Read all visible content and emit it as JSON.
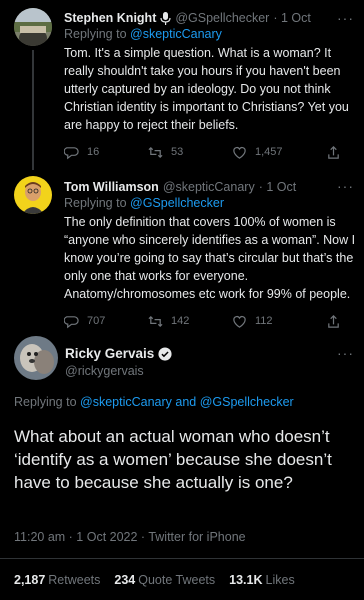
{
  "tweets": [
    {
      "name": "Stephen Knight",
      "handle": "@GSpellchecker",
      "time": "· 1 Oct",
      "reply_prefix": "Replying to ",
      "reply_to": "@skepticCanary",
      "text": "Tom. It's a simple question. What is a woman? It really shouldn't take you hours if you haven't been utterly captured by an ideology. Do you not think Christian identity is important to Christians? Yet you are happy to reject their beliefs.",
      "replies": "16",
      "retweets": "53",
      "likes": "1,457"
    },
    {
      "name": "Tom Williamson",
      "handle": "@skepticCanary",
      "time": "· 1 Oct",
      "reply_prefix": "Replying to ",
      "reply_to": "@GSpellchecker",
      "text": "The only definition that covers 100% of women is “anyone who sincerely identifies as a woman”. Now I know you’re going to say that’s circular but that’s the only one that works for everyone. Anatomy/chromosomes etc work for 99% of people.",
      "replies": "707",
      "retweets": "142",
      "likes": "112"
    }
  ],
  "main": {
    "name": "Ricky Gervais",
    "handle": "@rickygervais",
    "reply_prefix": "Replying to ",
    "reply_to_1": "@skepticCanary",
    "reply_and": " and ",
    "reply_to_2": "@GSpellchecker",
    "text": "What about an actual woman who doesn’t ‘identify as a women’ because she doesn’t have to because she actually is one?",
    "timestamp": "11:20 am · 1 Oct 2022 · Twitter for iPhone",
    "retweets_count": "2,187",
    "retweets_label": "Retweets",
    "quotes_count": "234",
    "quotes_label": "Quote Tweets",
    "likes_count": "13.1K",
    "likes_label": "Likes"
  },
  "more_label": "···",
  "colors": {
    "background": "#000000",
    "link": "#1d9bf0",
    "muted": "#71767b",
    "text": "#e7e9ea"
  }
}
